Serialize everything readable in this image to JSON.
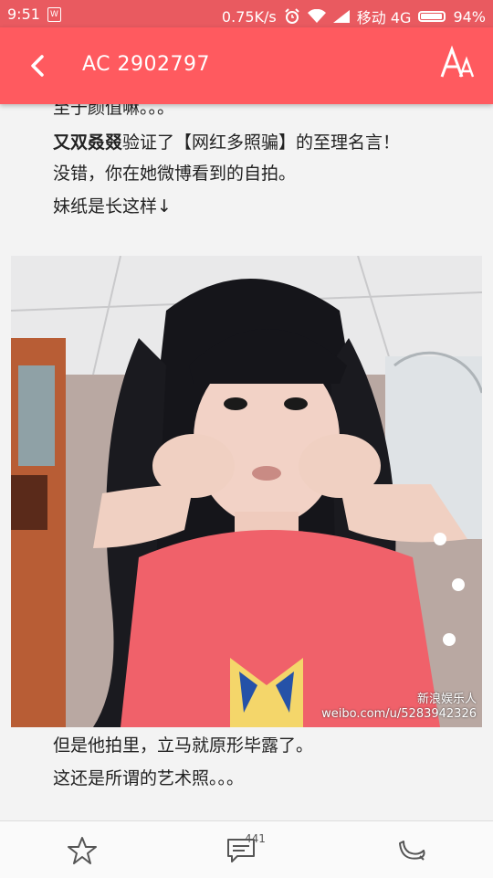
{
  "status_bar": {
    "time": "9:51",
    "app_icon": "W",
    "net_speed": "0.75K/s",
    "carrier": "移动 4G",
    "battery": "94%",
    "battery_level": 0.94
  },
  "header": {
    "title": "AC 2902797",
    "back_icon": "chevron-left-icon",
    "font_icon": "font-size-icon"
  },
  "article": {
    "line_top_partial": "至于颜值嘛。。。",
    "line1_bold": "又双叒叕",
    "line1_rest": "验证了【网红多照骗】的至理名言！",
    "line2": "没错，你在她微博看到的自拍。",
    "line3": "妹纸是长这样↓",
    "image_watermark_line1": "新浪娱乐人",
    "image_watermark_line2": "weibo.com/u/5283942326",
    "line4": "但是他拍里，立马就原形毕露了。",
    "line5": "这还是所谓的艺术照。。。"
  },
  "bottom_bar": {
    "favorite_icon": "star-icon",
    "comment_icon": "comment-icon",
    "comment_count": "441",
    "banana_icon": "banana-icon"
  },
  "colors": {
    "accent": "#ff5a5f",
    "status_bar": "#e95a60"
  }
}
